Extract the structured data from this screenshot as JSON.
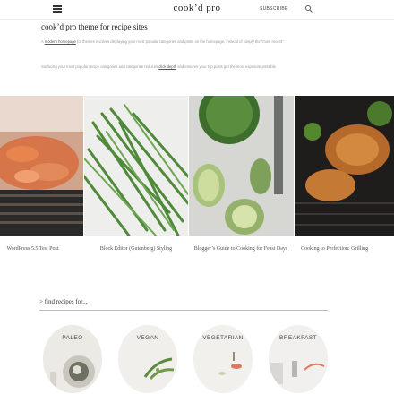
{
  "header": {
    "brand": "cook’d pro",
    "subscribe_label": "SUBSCRIBE"
  },
  "intro": {
    "title": "cook’d pro theme for recipe sites",
    "p1_link": "modern homepage",
    "p1_text": " for themes involves displaying your most popular categories and posts on the homepage, instead of simply the “most recent”.",
    "p1_prefix": "A ",
    "p2_prefix": "Surfacing your most popular recipe categories and categories reduces ",
    "p2_link": "click depth",
    "p2_text": " and ensures your top posts get the most exposure possible."
  },
  "posts": [
    {
      "title": "WordPress 5.5 Test Post"
    },
    {
      "title": "Block Editor (Gutenberg) Styling"
    },
    {
      "title": "Blogger’s Guide to Cooking for Feast Days"
    },
    {
      "title": "Cooking to Perfection: Grilling"
    }
  ],
  "find": {
    "heading": "find recipes for..."
  },
  "categories": [
    {
      "label": "PALEO"
    },
    {
      "label": "VEGAN"
    },
    {
      "label": "VEGETARIAN"
    },
    {
      "label": "BREAKFAST"
    }
  ],
  "colors": {
    "text": "#333333",
    "muted": "#999999",
    "rule": "#bbbbbb"
  }
}
